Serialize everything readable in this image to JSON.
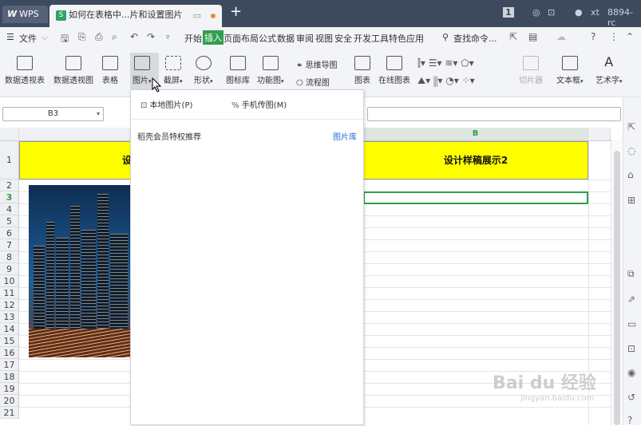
{
  "titlebar": {
    "wps_label": "WPS",
    "doc_tab_title": "如何在表格中...片和设置图片",
    "tab_badge": "1",
    "user_name": "xt",
    "user_id": "8894-rc"
  },
  "menubar": {
    "file_label": "文件",
    "tabs": [
      "开始",
      "插入",
      "页面布局",
      "公式",
      "数据",
      "审阅",
      "视图",
      "安全",
      "开发工具",
      "特色应用"
    ],
    "active_tab": "插入",
    "search_label": "查找命令..."
  },
  "ribbon": {
    "pivot_table": "数据透视表",
    "pivot_chart": "数据透视图",
    "table": "表格",
    "picture": "图片",
    "screenshot": "截屏",
    "shape": "形状",
    "icon_lib": "图标库",
    "function_chart": "功能图",
    "mindmap": "思维导图",
    "flowchart": "流程图",
    "chart": "图表",
    "online_chart": "在线图表",
    "slicer": "切片器",
    "textbox": "文本框",
    "wordart": "艺术字"
  },
  "namebox": {
    "value": "B3"
  },
  "dropdown": {
    "local_picture": "本地图片(P)",
    "phone_picture": "手机传图(M)",
    "section_title": "稻壳会员特权推荐",
    "library_link": "图片库"
  },
  "sheet": {
    "col_b": "B",
    "rows": [
      "1",
      "2",
      "3",
      "4",
      "5",
      "6",
      "7",
      "8",
      "9",
      "10",
      "11",
      "12",
      "13",
      "14",
      "15",
      "16",
      "17",
      "18",
      "19",
      "20",
      "21"
    ],
    "selected_row": "3",
    "a1_text_visible": "设",
    "b1_text": "设计样稿展示2"
  },
  "watermark": {
    "main": "Bai du 经验",
    "sub": "jingyan.baidu.com"
  },
  "colors": {
    "accent": "#2e9e4f",
    "header_fill": "#ffff00",
    "title_bg": "#3d4a5e"
  }
}
